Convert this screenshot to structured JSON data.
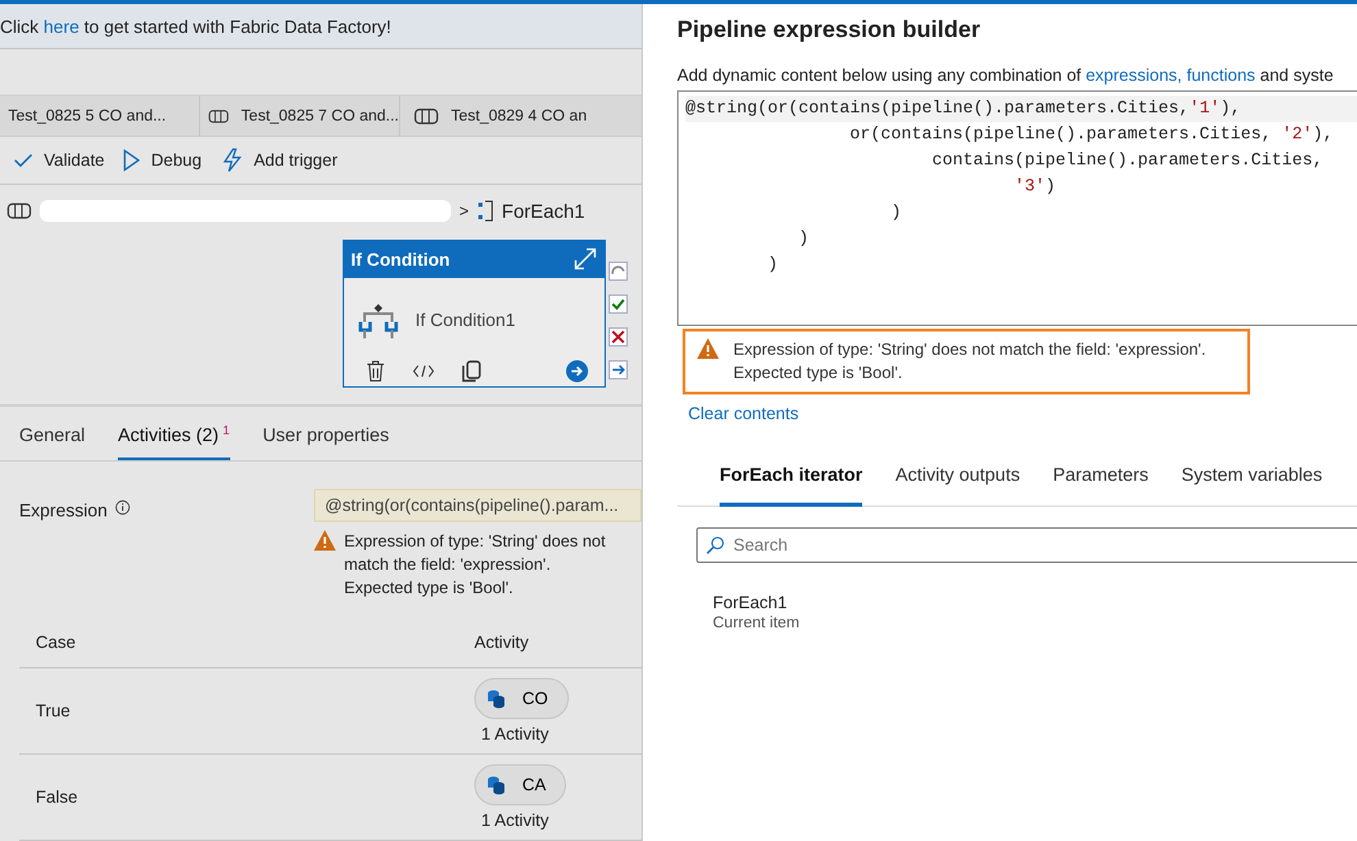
{
  "banner": {
    "before": "Click ",
    "link": "here",
    "after": " to get started with Fabric Data Factory!"
  },
  "pipeline_tabs": [
    {
      "label": "Test_0825 5 CO and...",
      "icon": false
    },
    {
      "label": "Test_0825 7 CO and...",
      "icon": true
    },
    {
      "label": "Test_0829 4 CO an",
      "icon": true
    }
  ],
  "toolbar": [
    {
      "kind": "validate",
      "label": "Validate"
    },
    {
      "kind": "debug",
      "label": "Debug"
    },
    {
      "kind": "trigger",
      "label": "Add trigger"
    }
  ],
  "breadcrumb": {
    "separator": ">",
    "current": "ForEach1"
  },
  "activity_card": {
    "type": "If Condition",
    "name": "If Condition1"
  },
  "properties": {
    "tabs": [
      {
        "label": "General",
        "selected": false
      },
      {
        "label": "Activities (2)",
        "selected": true,
        "badge": "1"
      },
      {
        "label": "User properties",
        "selected": false
      }
    ],
    "expression_label": "Expression",
    "expression_value": "@string(or(contains(pipeline().param...",
    "warning": [
      "Expression of type: 'String' does not",
      "match the field: 'expression'.",
      "Expected type is 'Bool'."
    ],
    "columns": [
      "Case",
      "Activity"
    ],
    "rows": [
      {
        "case": "True",
        "activity": "CO",
        "count": "1 Activity"
      },
      {
        "case": "False",
        "activity": "CA",
        "count": "1 Activity"
      }
    ]
  },
  "builder": {
    "title": "Pipeline expression builder",
    "description": {
      "before": "Add dynamic content below using any combination of ",
      "link": "expressions, functions",
      "after": " and syste"
    },
    "code": [
      [
        {
          "kind": "code",
          "text": "@string(or(contains(pipeline().parameters.Cities,"
        },
        {
          "kind": "string",
          "text": "'1'"
        },
        {
          "kind": "code",
          "text": "),"
        }
      ],
      [
        {
          "kind": "code",
          "text": "                or(contains(pipeline().parameters.Cities, "
        },
        {
          "kind": "string",
          "text": "'2'"
        },
        {
          "kind": "code",
          "text": "),"
        }
      ],
      [
        {
          "kind": "code",
          "text": "                        contains(pipeline().parameters.Cities,"
        }
      ],
      [
        {
          "kind": "string",
          "text": "                                '3'"
        },
        {
          "kind": "code",
          "text": ")"
        }
      ],
      [
        {
          "kind": "code",
          "text": "                    )"
        }
      ],
      [
        {
          "kind": "code",
          "text": "           )"
        }
      ],
      [
        {
          "kind": "code",
          "text": "        )"
        }
      ]
    ],
    "warning": [
      "Expression of type: 'String' does not match the field: 'expression'.",
      "Expected type is 'Bool'."
    ],
    "clear": "Clear contents",
    "tabs": [
      {
        "label": "ForEach iterator",
        "selected": true
      },
      {
        "label": "Activity outputs",
        "selected": false
      },
      {
        "label": "Parameters",
        "selected": false
      },
      {
        "label": "System variables",
        "selected": false
      }
    ],
    "search": {
      "placeholder": "Search"
    },
    "items": [
      {
        "title": "ForEach1",
        "subtitle": "Current item"
      }
    ]
  }
}
